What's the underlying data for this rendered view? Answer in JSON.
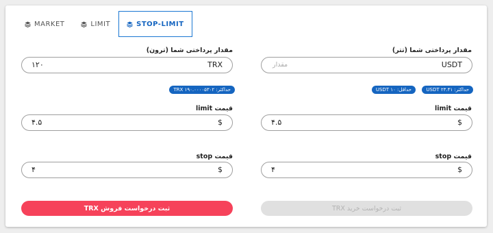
{
  "tabs": [
    {
      "label": "MARKET"
    },
    {
      "label": "LIMIT"
    },
    {
      "label": "STOP-LIMIT"
    }
  ],
  "sell": {
    "amount_label": "مقدار پرداختی شما (ترون)",
    "amount_currency": "TRX",
    "amount_value": "۱۲۰",
    "max_chip": "حداکثر: TRX ۱۹۰.۰۰۰۰۵۳۰۲",
    "limit_label": "قیمت limit",
    "limit_currency": "$",
    "limit_value": "۴.۵",
    "stop_label": "قیمت stop",
    "stop_currency": "$",
    "stop_value": "۴",
    "submit_label": "ثبت درخواست فروش TRX"
  },
  "buy": {
    "amount_label": "مقدار پرداختی شما (تتر)",
    "amount_currency": "USDT",
    "amount_placeholder": "مقدار",
    "max_chip": "حداکثر: USDT ۲۳.۴۱",
    "min_chip": "حداقل: USDT ۱۰",
    "limit_label": "قیمت limit",
    "limit_currency": "$",
    "limit_value": "۴.۵",
    "stop_label": "قیمت stop",
    "stop_currency": "$",
    "stop_value": "۴",
    "submit_label": "ثبت درخواست خرید TRX"
  },
  "colors": {
    "accent": "#1565c0",
    "sell_button": "#f6425a",
    "disabled_button": "#e0e0e0"
  },
  "icons": {
    "tab_icon": "layers-icon"
  }
}
